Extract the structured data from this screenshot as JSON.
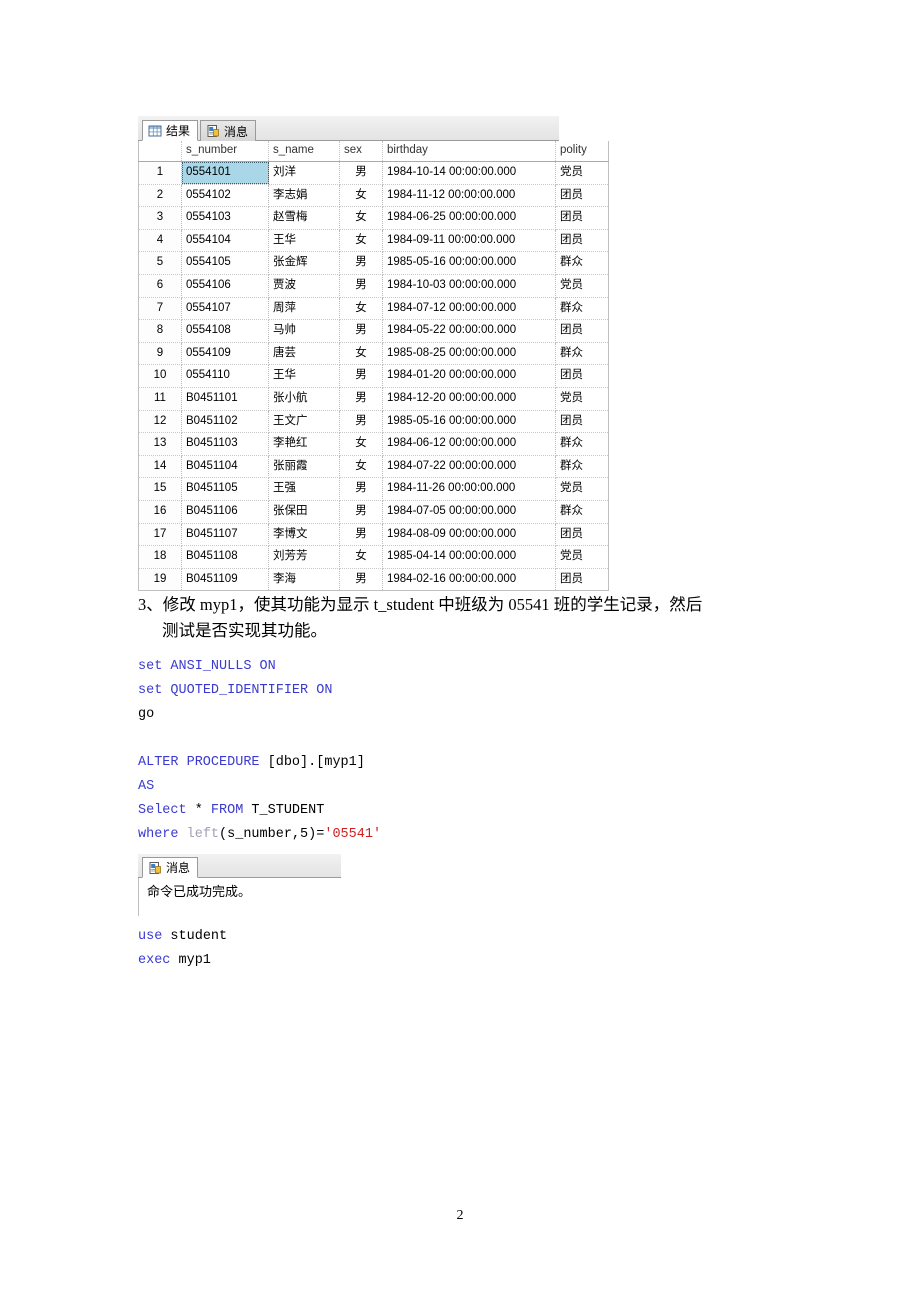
{
  "results_panel": {
    "tabs": [
      {
        "label": "结果",
        "icon": "grid-icon",
        "active": true
      },
      {
        "label": "消息",
        "icon": "message-report-icon",
        "active": false
      }
    ],
    "columns": [
      "",
      "s_number",
      "s_name",
      "sex",
      "birthday",
      "polity"
    ],
    "rows": [
      [
        "1",
        "0554101",
        "刘洋",
        "男",
        "1984-10-14 00:00:00.000",
        "党员"
      ],
      [
        "2",
        "0554102",
        "李志娟",
        "女",
        "1984-11-12 00:00:00.000",
        "团员"
      ],
      [
        "3",
        "0554103",
        "赵雪梅",
        "女",
        "1984-06-25 00:00:00.000",
        "团员"
      ],
      [
        "4",
        "0554104",
        "王华",
        "女",
        "1984-09-11 00:00:00.000",
        "团员"
      ],
      [
        "5",
        "0554105",
        "张金辉",
        "男",
        "1985-05-16 00:00:00.000",
        "群众"
      ],
      [
        "6",
        "0554106",
        "贾波",
        "男",
        "1984-10-03 00:00:00.000",
        "党员"
      ],
      [
        "7",
        "0554107",
        "周萍",
        "女",
        "1984-07-12 00:00:00.000",
        "群众"
      ],
      [
        "8",
        "0554108",
        "马帅",
        "男",
        "1984-05-22 00:00:00.000",
        "团员"
      ],
      [
        "9",
        "0554109",
        "唐芸",
        "女",
        "1985-08-25 00:00:00.000",
        "群众"
      ],
      [
        "10",
        "0554110",
        "王华",
        "男",
        "1984-01-20 00:00:00.000",
        "团员"
      ],
      [
        "11",
        "B0451101",
        "张小航",
        "男",
        "1984-12-20 00:00:00.000",
        "党员"
      ],
      [
        "12",
        "B0451102",
        "王文广",
        "男",
        "1985-05-16 00:00:00.000",
        "团员"
      ],
      [
        "13",
        "B0451103",
        "李艳红",
        "女",
        "1984-06-12 00:00:00.000",
        "群众"
      ],
      [
        "14",
        "B0451104",
        "张丽霞",
        "女",
        "1984-07-22 00:00:00.000",
        "群众"
      ],
      [
        "15",
        "B0451105",
        "王强",
        "男",
        "1984-11-26 00:00:00.000",
        "党员"
      ],
      [
        "16",
        "B0451106",
        "张保田",
        "男",
        "1984-07-05 00:00:00.000",
        "群众"
      ],
      [
        "17",
        "B0451107",
        "李博文",
        "男",
        "1984-08-09 00:00:00.000",
        "团员"
      ],
      [
        "18",
        "B0451108",
        "刘芳芳",
        "女",
        "1985-04-14 00:00:00.000",
        "党员"
      ],
      [
        "19",
        "B0451109",
        "李海",
        "男",
        "1984-02-16 00:00:00.000",
        "团员"
      ]
    ],
    "selected_cell": {
      "row": 0,
      "col": 1
    }
  },
  "task": {
    "line1": "3、修改 myp1，使其功能为显示 t_student 中班级为 05541 班的学生记录，然后",
    "line2": "测试是否实现其功能。"
  },
  "code_block_1": {
    "l1_kw": "set",
    "l1_rest": " ANSI_NULLS ON",
    "l2_kw": "set",
    "l2_rest": " QUOTED_IDENTIFIER ON",
    "l3": "go"
  },
  "code_block_2": {
    "l1_kw": "ALTER PROCEDURE",
    "l1_rest": " [dbo].[myp1]",
    "l2_kw": "AS",
    "l3_kw": "Select",
    "l3_star": " * ",
    "l3_from": "FROM",
    "l3_tbl": " T_STUDENT",
    "l4_kw": "where",
    "l4_fn": " left",
    "l4_args": "(s_number,5)=",
    "l4_str": "'05541'"
  },
  "code_block_3": {
    "l1_kw": "use",
    "l1_rest": " student",
    "l2_kw": "exec",
    "l2_rest": " myp1"
  },
  "messages_panel": {
    "tab_label": "消息",
    "tab_icon": "message-report-icon",
    "text": "命令已成功完成。"
  },
  "page_number": "2",
  "colors": {
    "sql_keyword": "#3a3ad0",
    "sql_string": "#d22020",
    "sql_function": "#a0a0b4",
    "selection": "#a9d7e8",
    "grid_border": "#c0c0c0"
  }
}
